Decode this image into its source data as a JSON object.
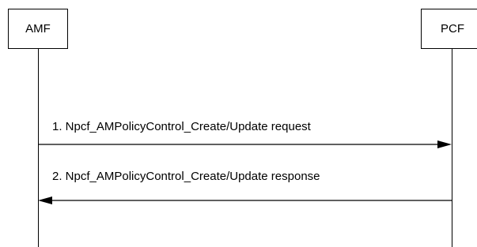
{
  "diagram": {
    "entities": {
      "amf": "AMF",
      "pcf": "PCF"
    },
    "messages": [
      {
        "label": "1. Npcf_AMPolicyControl_Create/Update request",
        "from": "AMF",
        "to": "PCF"
      },
      {
        "label": "2. Npcf_AMPolicyControl_Create/Update response",
        "from": "PCF",
        "to": "AMF"
      }
    ]
  }
}
